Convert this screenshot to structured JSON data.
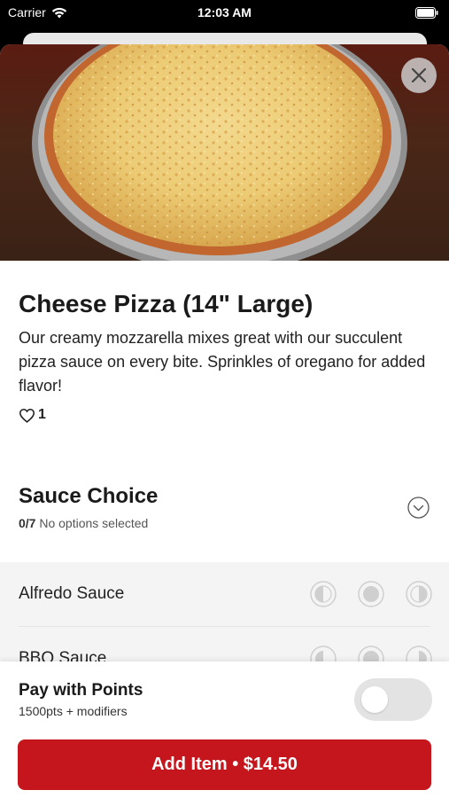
{
  "status_bar": {
    "carrier": "Carrier",
    "time": "12:03 AM"
  },
  "item": {
    "title": "Cheese Pizza (14\" Large)",
    "description": "Our creamy mozzarella mixes great with our succulent pizza sauce on every bite. Sprinkles of oregano for added flavor!",
    "likes": "1"
  },
  "sauce_section": {
    "title": "Sauce Choice",
    "count": "0/7",
    "status": "No options selected",
    "options": [
      {
        "label": "Alfredo Sauce"
      },
      {
        "label": "BBQ Sauce"
      }
    ]
  },
  "footer": {
    "points_title": "Pay with Points",
    "points_sub": "1500pts + modifiers",
    "points_toggle_on": false,
    "add_button": "Add Item • $14.50"
  },
  "colors": {
    "accent": "#c4161c"
  },
  "icons": [
    "wifi-icon",
    "battery-icon",
    "close-icon",
    "heart-icon",
    "chevron-down-icon",
    "left-half-icon",
    "whole-icon",
    "right-half-icon"
  ]
}
